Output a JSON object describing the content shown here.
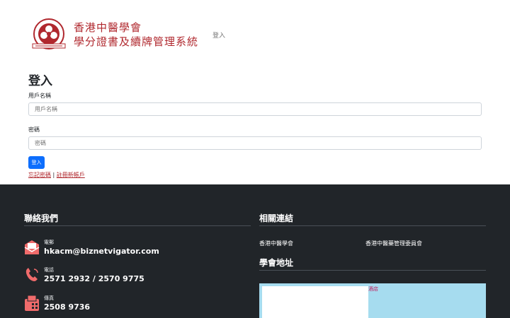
{
  "header": {
    "logo_line1": "香港中醫學會",
    "logo_line2": "學分證書及續牌管理系統",
    "nav_link": "登入"
  },
  "login": {
    "title": "登入",
    "username_label": "用戶名稱",
    "username_placeholder": "用戶名稱",
    "password_label": "密碼",
    "password_placeholder": "密碼",
    "submit_label": "登入",
    "forgot_password": "忘記密碼",
    "separator": "|",
    "register": "註冊新帳戶"
  },
  "footer": {
    "contact_title": "聯絡我們",
    "email_label": "電郵",
    "email_value": "hkacm@biznetvigator.com",
    "phone_label": "電話",
    "phone_value": "2571 2932 / 2570 9775",
    "fax_label": "傳真",
    "fax_value": "2508 9736",
    "links_title": "相關連結",
    "link1": "香港中醫學會",
    "link2": "香港中醫藥管理委員會",
    "map_title": "學會地址",
    "map_label": "酒店"
  },
  "colors": {
    "brand_red": "#b0282e",
    "primary_blue": "#0d6efd",
    "footer_bg": "#212529",
    "icon_coral": "#f06b6b"
  }
}
